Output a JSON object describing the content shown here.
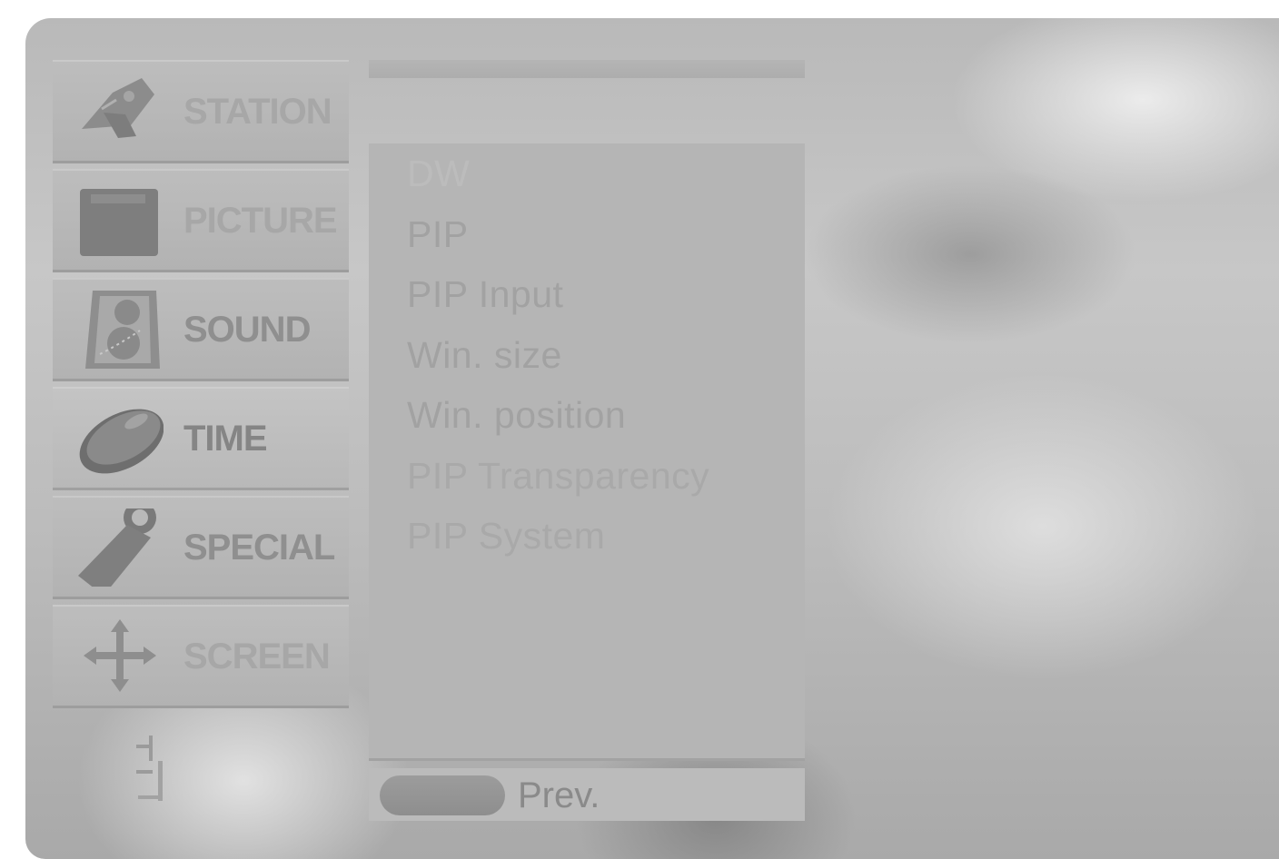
{
  "sidebar": {
    "items": [
      {
        "label": "STATION",
        "icon": "satellite-dish-icon"
      },
      {
        "label": "PICTURE",
        "icon": "picture-icon"
      },
      {
        "label": "SOUND",
        "icon": "speaker-icon"
      },
      {
        "label": "TIME",
        "icon": "clock-icon"
      },
      {
        "label": "SPECIAL",
        "icon": "tag-icon"
      },
      {
        "label": "SCREEN",
        "icon": "move-arrows-icon"
      }
    ],
    "active_index": 3
  },
  "submenu": {
    "items": [
      {
        "label": "DW"
      },
      {
        "label": "PIP"
      },
      {
        "label": "PIP Input"
      },
      {
        "label": "Win. size"
      },
      {
        "label": "Win. position"
      },
      {
        "label": "PIP Transparency"
      },
      {
        "label": "PIP System"
      }
    ]
  },
  "footer": {
    "prev_label": "Prev."
  }
}
